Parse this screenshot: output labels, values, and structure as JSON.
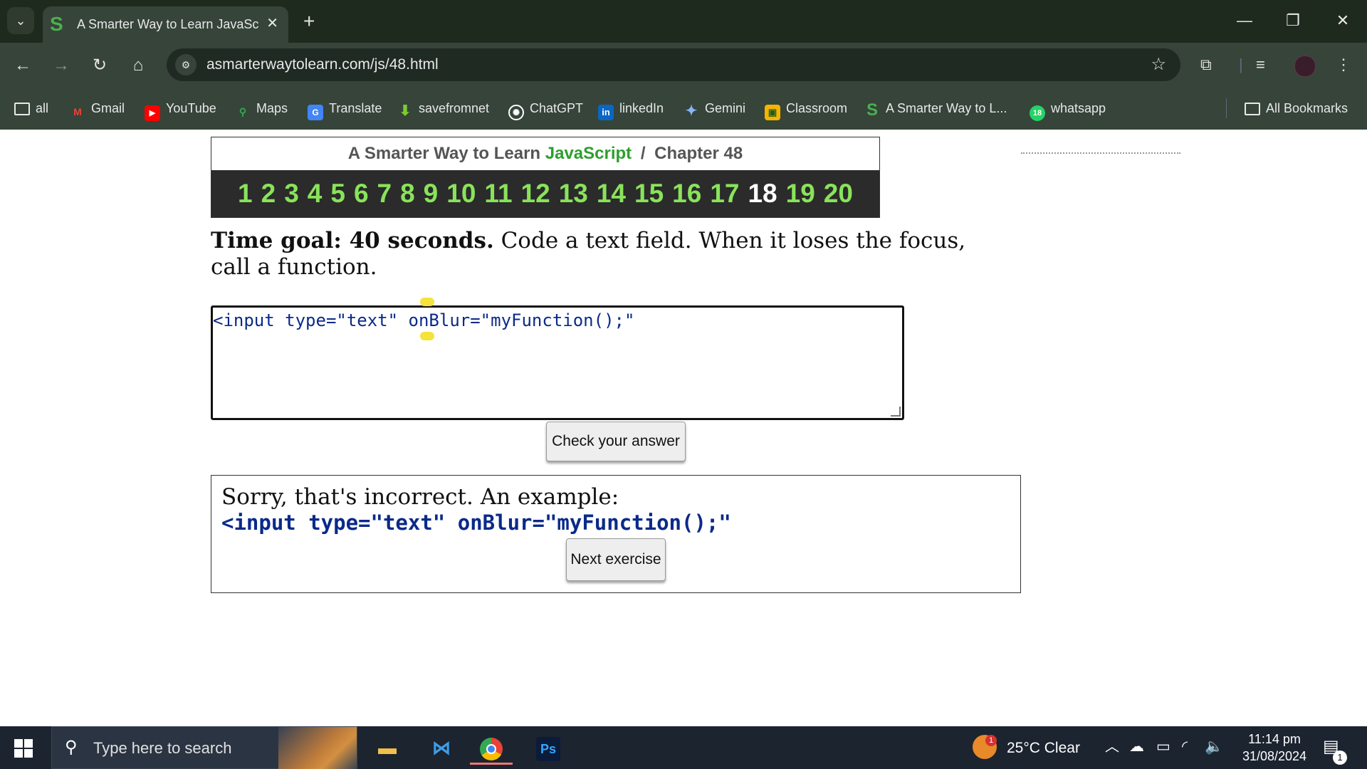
{
  "browser": {
    "tab_title": "A Smarter Way to Learn JavaScr",
    "tab_favicon": "S",
    "url": "asmarterwaytolearn.com/js/48.html",
    "bookmarks": [
      {
        "label": "all",
        "icon": "folder-icon"
      },
      {
        "label": "Gmail",
        "icon": "gmail-icon",
        "color": "#ea4335"
      },
      {
        "label": "YouTube",
        "icon": "youtube-icon",
        "color": "#ff0000"
      },
      {
        "label": "Maps",
        "icon": "maps-pin-icon",
        "color": "#34a853"
      },
      {
        "label": "Translate",
        "icon": "translate-icon",
        "color": "#4285f4"
      },
      {
        "label": "savefromnet",
        "icon": "download-arrow-icon",
        "color": "#7ccc2e"
      },
      {
        "label": "ChatGPT",
        "icon": "chatgpt-icon",
        "color": "#ffffff"
      },
      {
        "label": "linkedIn",
        "icon": "linkedin-icon",
        "color": "#0a66c2"
      },
      {
        "label": "Gemini",
        "icon": "gemini-icon",
        "color": "#8ab4f8"
      },
      {
        "label": "Classroom",
        "icon": "classroom-icon",
        "color": "#f4b400"
      },
      {
        "label": "A Smarter Way to L...",
        "icon": "smarter-way-icon",
        "color": "#4caf50"
      },
      {
        "label": "whatsapp",
        "icon": "whatsapp-icon",
        "color": "#25d366",
        "badge": "18"
      }
    ],
    "all_bookmarks": "All Bookmarks"
  },
  "page": {
    "header_prefix": "A Smarter Way to Learn",
    "header_js": "JavaScript",
    "header_sep": "/",
    "header_chapter": "Chapter 48",
    "chapters": [
      "1",
      "2",
      "3",
      "4",
      "5",
      "6",
      "7",
      "8",
      "9",
      "10",
      "11",
      "12",
      "13",
      "14",
      "15",
      "16",
      "17",
      "18",
      "19",
      "20"
    ],
    "current_chapter": "18",
    "goal_bold": "Time goal: 40 seconds.",
    "goal_text": " Code a text field. When it loses the focus, call a function.",
    "answer_value": "<input type=\"text\" onBlur=\"myFunction();\"",
    "check_button": "Check your answer",
    "result_message": "Sorry, that's incorrect. An example:",
    "result_code": "<input type=\"text\" onBlur=\"myFunction();\"",
    "next_button": "Next exercise"
  },
  "taskbar": {
    "search_placeholder": "Type here to search",
    "weather": "25°C  Clear",
    "weather_badge": "1",
    "time": "11:14 pm",
    "date": "31/08/2024",
    "notification_count": "1",
    "apps": [
      {
        "name": "file-explorer-icon"
      },
      {
        "name": "vscode-icon"
      },
      {
        "name": "chrome-icon"
      },
      {
        "name": "photoshop-icon",
        "label": "Ps"
      }
    ]
  }
}
